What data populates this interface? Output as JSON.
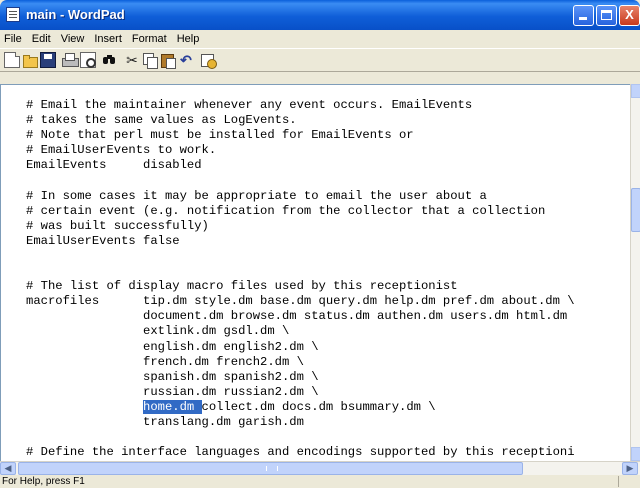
{
  "window": {
    "title": "main - WordPad",
    "minimize_label": "",
    "maximize_label": "",
    "close_label": "X"
  },
  "menu": [
    "File",
    "Edit",
    "View",
    "Insert",
    "Format",
    "Help"
  ],
  "toolbar": {
    "icons": [
      "new-icon",
      "open-icon",
      "save-icon",
      "print-icon",
      "print-preview-icon",
      "find-icon",
      "cut-icon",
      "copy-icon",
      "paste-icon",
      "undo-icon",
      "date-time-icon"
    ]
  },
  "document": {
    "lines": [
      "# Email the maintainer whenever any event occurs. EmailEvents",
      "# takes the same values as LogEvents.",
      "# Note that perl must be installed for EmailEvents or",
      "# EmailUserEvents to work.",
      "EmailEvents     disabled",
      "",
      "# In some cases it may be appropriate to email the user about a",
      "# certain event (e.g. notification from the collector that a collection",
      "# was built successfully)",
      "EmailUserEvents false",
      "",
      "",
      "# The list of display macro files used by this receptionist",
      "macrofiles      tip.dm style.dm base.dm query.dm help.dm pref.dm about.dm \\",
      "                document.dm browse.dm status.dm authen.dm users.dm html.dm",
      "                extlink.dm gsdl.dm \\",
      "                english.dm english2.dm \\",
      "                french.dm french2.dm \\",
      "                spanish.dm spanish2.dm \\",
      "                russian.dm russian2.dm \\",
      "                @@SEL@@collect.dm docs.dm bsummary.dm \\",
      "                translang.dm garish.dm",
      "",
      "# Define the interface languages and encodings supported by this receptioni"
    ],
    "selected_text": "home.dm "
  },
  "scrollbars": {
    "left_arrow": "◀",
    "right_arrow": "▶"
  },
  "status": {
    "text": "For Help, press F1"
  }
}
